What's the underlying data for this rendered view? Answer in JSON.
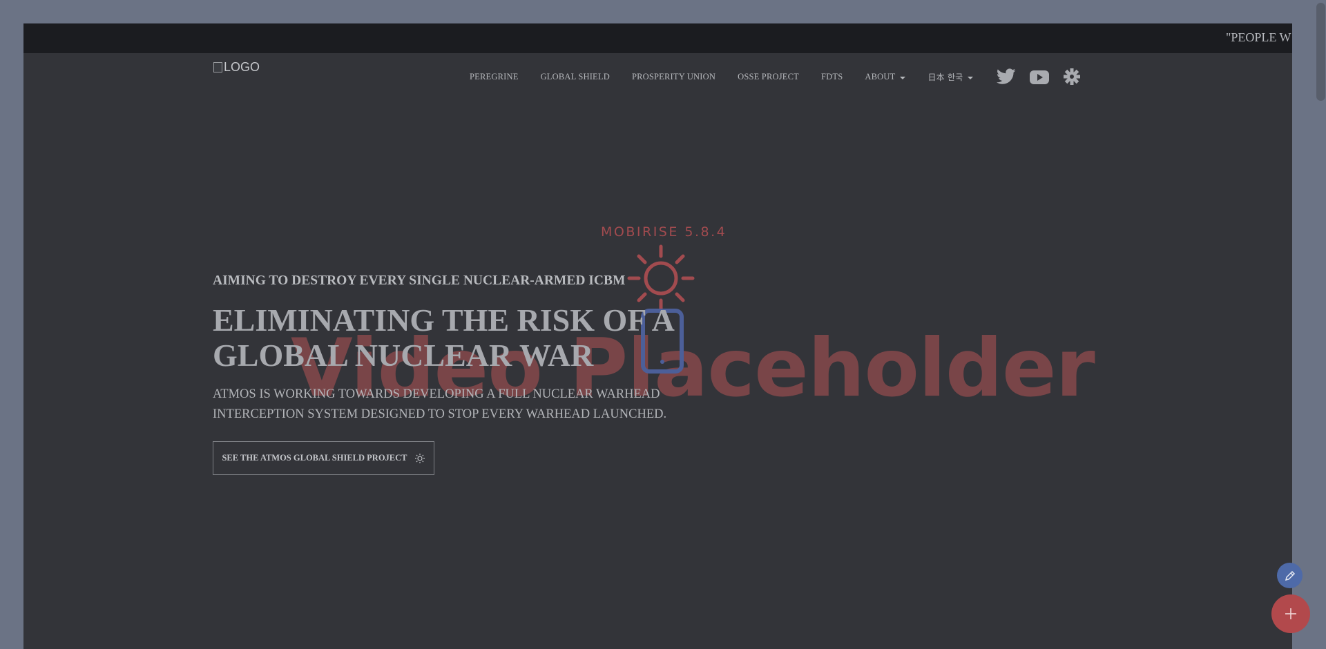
{
  "ticker": {
    "text": "\"PEOPLE W"
  },
  "header": {
    "logo_alt": "LOGO",
    "nav": [
      {
        "label": "PEREGRINE"
      },
      {
        "label": "GLOBAL SHIELD"
      },
      {
        "label": "PROSPERITY UNION"
      },
      {
        "label": "OSSE PROJECT"
      },
      {
        "label": "FDTS"
      },
      {
        "label": "ABOUT"
      },
      {
        "label": "日本 한국"
      }
    ],
    "social_icons": [
      "twitter-icon",
      "youtube-icon",
      "puzzle-icon"
    ]
  },
  "hero": {
    "subtitle": "AIMING TO DESTROY EVERY SINGLE NUCLEAR-ARMED ICBM",
    "title": "ELIMINATING THE RISK OF A GLOBAL NUCLEAR WAR",
    "description": "ATMOS IS WORKING TOWARDS DEVELOPING A FULL NUCLEAR WARHEAD INTERCEPTION SYSTEM DESIGNED TO STOP EVERY WARHEAD LAUNCHED.",
    "cta_label": "SEE THE ATMOS GLOBAL SHIELD PROJECT",
    "cta_icon": "sun-icon"
  },
  "video_placeholder": {
    "brand": "MOBIRISE  5.8.4",
    "text": "Video Placeholder"
  },
  "editor": {
    "edit_icon": "pencil-icon",
    "add_icon": "plus-icon"
  },
  "colors": {
    "page_background": "#6b7385",
    "frame_background": "#333439",
    "ticker_background": "#1b1c20",
    "placeholder_red": "#7d4649",
    "edit_fab": "#4e6aa8",
    "add_fab": "#b2494c"
  }
}
